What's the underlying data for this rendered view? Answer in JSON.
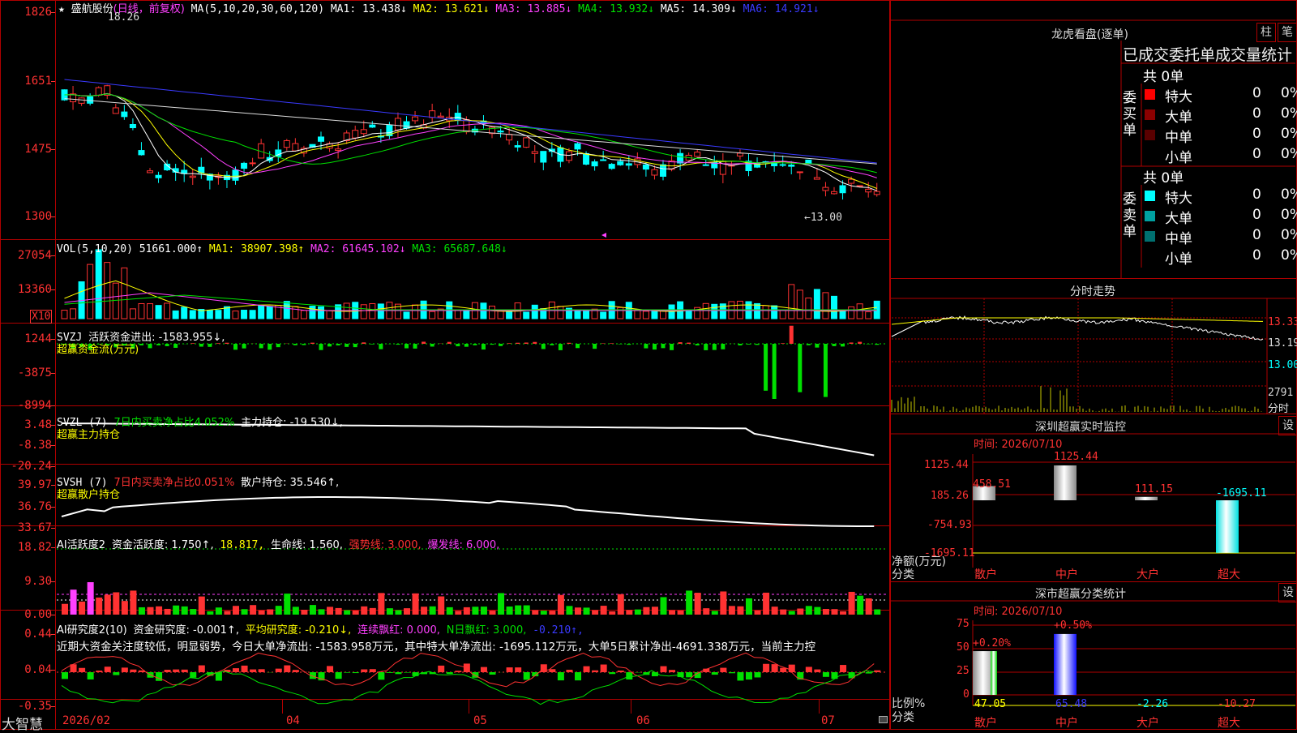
{
  "stock": {
    "star": "★",
    "name": "盛航股份",
    "period_tag": "(日线，前复权)",
    "ma_label": "MA(5,10,20,30,60,120)",
    "ma1": "MA1: 13.438↓",
    "ma2": "MA2: 13.621↓",
    "ma3": "MA3: 13.885↓",
    "ma4": "MA4: 13.932↓",
    "ma5": "MA5: 14.309↓",
    "ma6": "MA6: 14.921↓",
    "high_label": "18.26",
    "low_label": "←13.00"
  },
  "main_axis": [
    "1826",
    "1651",
    "1475",
    "1300"
  ],
  "vol": {
    "label": "VOL(5,10,20)",
    "value": "51661.000↑",
    "ma1": "MA1: 38907.398↑",
    "ma2": "MA2: 61645.102↓",
    "ma3": "MA3: 65687.648↓",
    "axis": [
      "27054",
      "13360"
    ],
    "unit": "X10"
  },
  "svzj": {
    "label": "SVZJ",
    "desc": "活跃资金进出: -1583.955↓,",
    "sub": "超赢资金流(万元)",
    "axis": [
      "1244",
      "-3875",
      "-8994"
    ]
  },
  "svzl": {
    "label": "SVZL (7)",
    "desc1": "7日内买卖净占比4.052%",
    "desc2": "主力持仓: -19.530↓,",
    "sub": "超赢主力持仓",
    "axis": [
      "3.48",
      "-8.38",
      "-20.24"
    ]
  },
  "svsh": {
    "label": "SVSH (7)",
    "desc1": "7日内买卖净占比0.051%",
    "desc2": "散户持仓: 35.546↑,",
    "sub": "超赢散户持仓",
    "axis": [
      "39.97",
      "36.76",
      "33.67"
    ]
  },
  "ai1": {
    "label": "AI活跃度2",
    "d1": "资金活跃度: 1.750↑,",
    "d2": "18.817,",
    "d3": "生命线: 1.560,",
    "d4": "强势线: 3.000,",
    "d5": "爆发线: 6.000,",
    "axis": [
      "18.82",
      "9.30",
      "0.00"
    ]
  },
  "ai2": {
    "label": "AI研究度2(10)",
    "d1": "资金研究度: -0.001↑,",
    "d2": "平均研究度: -0.210↓,",
    "d3": "连续飘红: 0.000,",
    "d4": "N日飘红: 3.000,",
    "d5": "-0.210↑,",
    "comment": "近期大资金关注度较低，明显弱势，今日大单净流出: -1583.958万元，其中特大单净流出: -1695.112万元，大单5日累计净出-4691.338万元，当前主力控",
    "axis": [
      "0.44",
      "0.04",
      "-0.35"
    ]
  },
  "xaxis": {
    "brand": "大智慧",
    "labels": [
      "2026/02",
      "04",
      "05",
      "06",
      "07"
    ]
  },
  "lhb": {
    "title": "龙虎看盘(逐单)",
    "tab1": "柱",
    "tab2": "笔",
    "header": "已成交委托单成交量统计",
    "buy_total": "共 0单",
    "buy_side": "委买单",
    "sell_total": "共 0单",
    "sell_side": "委卖单",
    "buy_rows": [
      {
        "name": "特大",
        "qty": "0",
        "pct": "0%",
        "color": "#ff0000"
      },
      {
        "name": "大单",
        "qty": "0",
        "pct": "0%",
        "color": "#8b0000"
      },
      {
        "name": "中单",
        "qty": "0",
        "pct": "0%",
        "color": "#5a0000"
      },
      {
        "name": "小单",
        "qty": "0",
        "pct": "0%",
        "color": ""
      }
    ],
    "sell_rows": [
      {
        "name": "特大",
        "qty": "0",
        "pct": "0%",
        "color": "#00ffff"
      },
      {
        "name": "大单",
        "qty": "0",
        "pct": "0%",
        "color": "#00a0a0"
      },
      {
        "name": "中单",
        "qty": "0",
        "pct": "0%",
        "color": "#007070"
      },
      {
        "name": "小单",
        "qty": "0",
        "pct": "0%",
        "color": ""
      }
    ]
  },
  "intraday": {
    "title": "分时走势",
    "axis": [
      "13.33",
      "13.19",
      "13.00"
    ],
    "vol_value": "2791",
    "vol_unit": "分时"
  },
  "monitor": {
    "title": "深圳超赢实时监控",
    "settings": "设",
    "time": "时间: 2026/07/10",
    "axis": [
      "1125.44",
      "185.26",
      "-754.93",
      "-1695.11"
    ],
    "unit": "净额(万元)",
    "cat_label": "分类",
    "categories": [
      "散户",
      "中户",
      "大户",
      "超大"
    ],
    "values": [
      458.51,
      1125.44,
      111.15,
      -1695.11
    ],
    "value_labels": [
      "458.51",
      "1125.44",
      "111.15",
      "-1695.11"
    ]
  },
  "classify": {
    "title": "深市超赢分类统计",
    "settings": "设",
    "time": "时间: 2026/07/10",
    "axis": [
      "75",
      "50",
      "25",
      "0"
    ],
    "unit": "比例%",
    "cat_label": "分类",
    "categories": [
      "散户",
      "中户",
      "大户",
      "超大"
    ],
    "top_labels": [
      "+0.20%",
      "+0.50%"
    ],
    "values": [
      "47.05",
      "65.48",
      "-2.26",
      "-10.27"
    ]
  }
}
